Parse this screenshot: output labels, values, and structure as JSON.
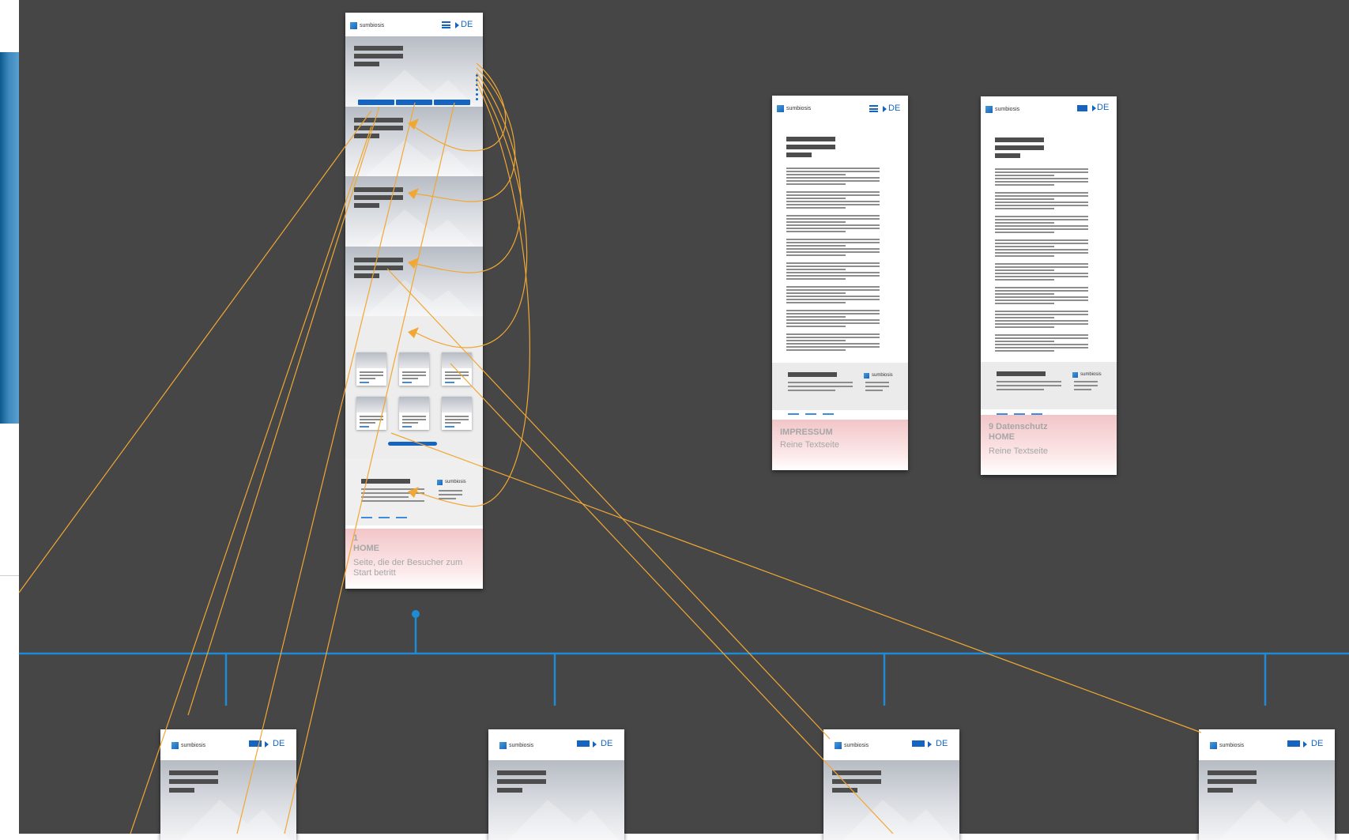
{
  "brand": {
    "logo_text": "sumbiosis"
  },
  "colors": {
    "canvas": "#464646",
    "accent_blue": "#1565c0",
    "connector": "#f0a733",
    "sitemap_line": "#1f8ad6",
    "label_pink": "#f2c5c8"
  },
  "home_page": {
    "lang": "DE",
    "label_number": "1",
    "label_title": "HOME",
    "label_description": "Seite, die der Besucher zum Start betritt"
  },
  "impressum_page": {
    "lang": "DE",
    "label_title": "IMPRESSUM",
    "label_description": "Reine Textseite"
  },
  "datenschutz_page": {
    "lang": "DE",
    "label_title": "9 Datenschutz",
    "label_subtitle": "HOME",
    "label_description": "Reine Textseite"
  },
  "child_pages": [
    {
      "logo_text": "sumbiosis",
      "lang": "DE"
    },
    {
      "logo_text": "sumbiosis",
      "lang": "DE"
    },
    {
      "logo_text": "sumbiosis",
      "lang": "DE"
    },
    {
      "logo_text": "sumbiosis",
      "lang": "DE"
    }
  ],
  "icons": [
    "hamburger-menu-icon",
    "language-arrow-icon",
    "logo-mark-icon",
    "mountain-placeholder-icon"
  ]
}
